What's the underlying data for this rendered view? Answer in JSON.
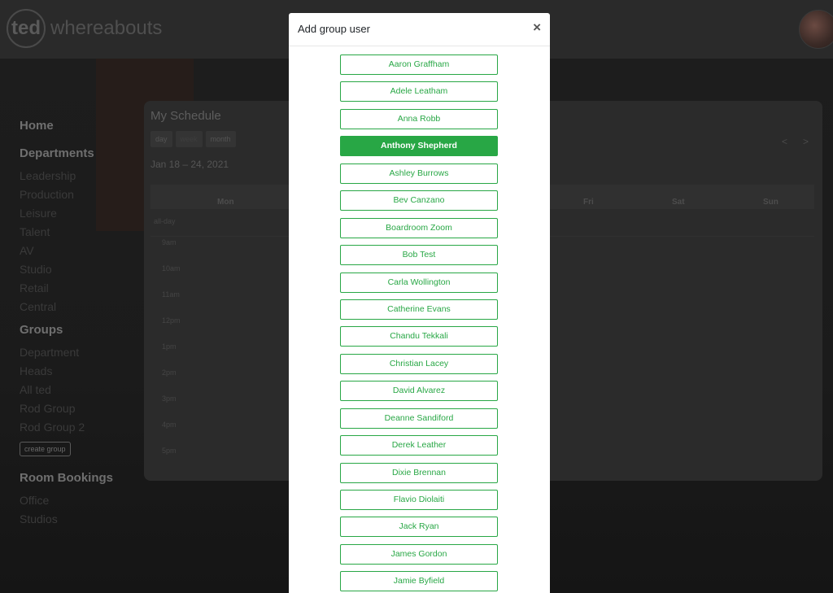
{
  "app": {
    "logo_mark": "ted",
    "logo_word": "whereabouts"
  },
  "sidebar": {
    "home": "Home",
    "departments_title": "Departments",
    "departments": [
      "Leadership",
      "Production",
      "Leisure",
      "Talent",
      "AV",
      "Studio",
      "Retail",
      "Central"
    ],
    "groups_title": "Groups",
    "groups": [
      "Department",
      "Heads",
      "All ted",
      "Rod Group",
      "Rod Group 2"
    ],
    "create_group": "create group",
    "rooms_title": "Room Bookings",
    "rooms": [
      "Office",
      "Studios"
    ]
  },
  "schedule": {
    "title": "My Schedule",
    "views": [
      "day",
      "week",
      "month"
    ],
    "range": "Jan 18 – 24, 2021",
    "nav_prev": "<",
    "nav_next": ">",
    "days": [
      "Mon",
      "Fri",
      "Sat",
      "Sun"
    ],
    "allday": "all-day",
    "times": [
      "9am",
      "10am",
      "11am",
      "12pm",
      "1pm",
      "2pm",
      "3pm",
      "4pm",
      "5pm"
    ]
  },
  "modal": {
    "title": "Add group user",
    "close": "×",
    "selected_user": "Anthony Shepherd",
    "users": [
      "Aaron Graffham",
      "Adele Leatham",
      "Anna Robb",
      "Anthony Shepherd",
      "Ashley Burrows",
      "Bev Canzano",
      "Boardroom Zoom",
      "Bob Test",
      "Carla Wollington",
      "Catherine Evans",
      "Chandu Tekkali",
      "Christian Lacey",
      "David Alvarez",
      "Deanne Sandiford",
      "Derek Leather",
      "Dixie Brennan",
      "Flavio Diolaiti",
      "Jack Ryan",
      "James Gordon",
      "Jamie Byfield"
    ]
  },
  "colors": {
    "accent": "#28a745",
    "overlay": "#1f1f1f"
  }
}
